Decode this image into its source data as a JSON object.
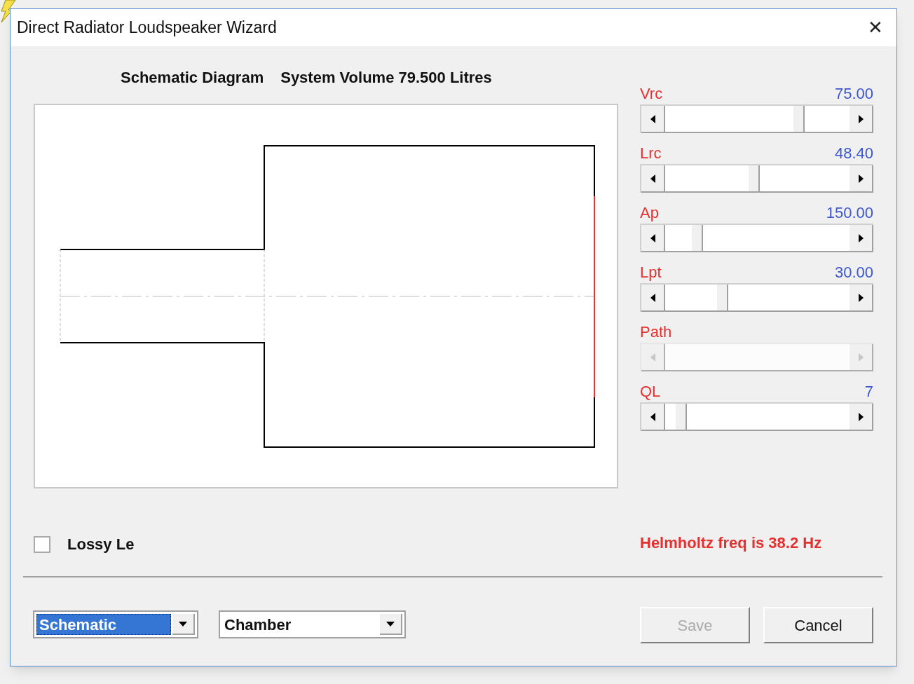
{
  "window": {
    "title": "Direct Radiator Loudspeaker Wizard",
    "close_glyph": "✕"
  },
  "header": {
    "left": "Schematic Diagram",
    "right": "System Volume 79.500 Litres"
  },
  "parameters": [
    {
      "name": "Vrc",
      "value": "75.00",
      "level": 0.74,
      "disabled": false
    },
    {
      "name": "Lrc",
      "value": "48.40",
      "level": 0.48,
      "disabled": false
    },
    {
      "name": "Ap",
      "value": "150.00",
      "level": 0.155,
      "disabled": false
    },
    {
      "name": "Lpt",
      "value": "30.00",
      "level": 0.3,
      "disabled": false
    },
    {
      "name": "Path",
      "disabled": true
    },
    {
      "name": "QL",
      "value": "7",
      "level": 0.06,
      "disabled": false
    }
  ],
  "lossy_le": {
    "label": "Lossy Le",
    "checked": false
  },
  "helmholtz": "Helmholtz freq is 38.2 Hz",
  "view_select": {
    "value": "Schematic",
    "focused": true
  },
  "part_select": {
    "value": "Chamber",
    "focused": false
  },
  "buttons": [
    {
      "label": "Save",
      "disabled": true
    },
    {
      "label": "Cancel",
      "disabled": false
    }
  ]
}
